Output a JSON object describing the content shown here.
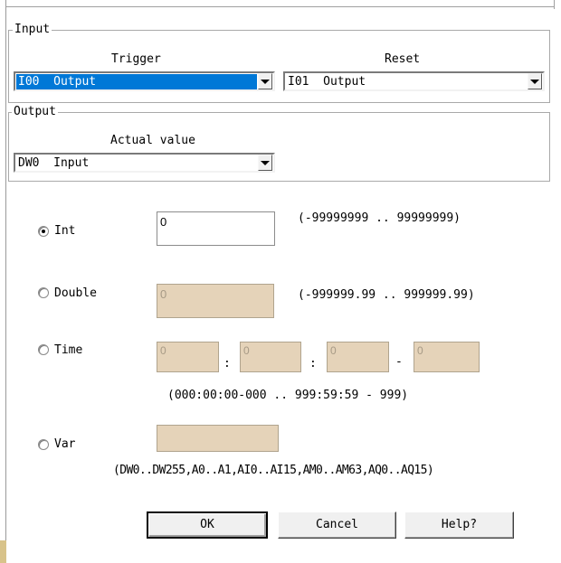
{
  "input_group": {
    "legend": "Input",
    "trigger": {
      "label": "Trigger",
      "value": "I00  Output"
    },
    "reset": {
      "label": "Reset",
      "value": "I01  Output"
    }
  },
  "output_group": {
    "legend": "Output",
    "actual_value": {
      "label": "Actual value",
      "value": "DW0  Input"
    }
  },
  "options": {
    "int": {
      "label": "Int",
      "value": "0",
      "range": "(-99999999 .. 99999999)"
    },
    "double": {
      "label": "Double",
      "value": "0",
      "range": "(-999999.99 .. 999999.99)"
    },
    "time": {
      "label": "Time",
      "fields": [
        "0",
        "0",
        "0",
        "0"
      ],
      "sep1": ":",
      "sep2": ":",
      "sep3": "-",
      "range": "(000:00:00-000 .. 999:59:59 - 999)"
    },
    "var": {
      "label": "Var",
      "value": "",
      "range": "(DW0..DW255,A0..A1,AI0..AI15,AM0..AM63,AQ0..AQ15)"
    }
  },
  "buttons": {
    "ok": "OK",
    "cancel": "Cancel",
    "help": "Help?"
  },
  "selected_option": "int",
  "colors": {
    "selection": "#0078d7",
    "disabled_field": "#e5d3b9",
    "window_accent": "#d8c38a"
  }
}
